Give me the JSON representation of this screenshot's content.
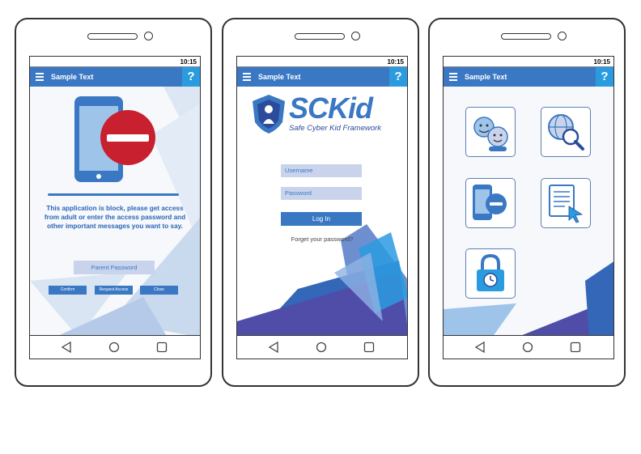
{
  "phones": [
    {
      "status_time": "10:15",
      "appbar_title": "Sample Text",
      "help_label": "?",
      "message": "This application is block, please get access from adult or enter the access password and other important messages you want to say.",
      "password_button": "Parent Password",
      "buttons": {
        "confirm": "Confirm",
        "request": "Request Access",
        "close": "Close"
      }
    },
    {
      "status_time": "10:15",
      "appbar_title": "Sample Text",
      "help_label": "?",
      "logo_text": "SCKid",
      "tagline": "Safe Cyber Kid Framework",
      "username_placeholder": "Username",
      "password_placeholder": "Password",
      "login_button": "Log In",
      "forgot_link": "Forget your password?"
    },
    {
      "status_time": "10:15",
      "appbar_title": "Sample Text",
      "help_label": "?",
      "tiles": [
        "contacts-tile-icon",
        "web-search-tile-icon",
        "app-block-tile-icon",
        "activity-log-tile-icon",
        "time-lock-tile-icon"
      ]
    }
  ],
  "colors": {
    "primary": "#3a78c4",
    "accent": "#2b9be0",
    "danger": "#c8202e",
    "field": "#c9d4ec"
  }
}
